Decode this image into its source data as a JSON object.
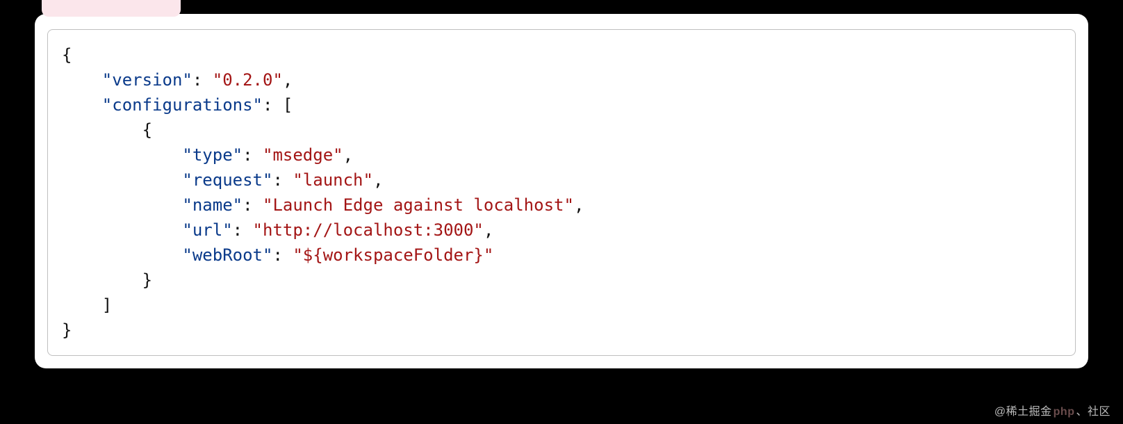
{
  "code": {
    "indent1": "    ",
    "indent2": "        ",
    "indent3": "            ",
    "open_brace": "{",
    "close_brace": "}",
    "open_bracket": "[",
    "close_bracket": "]",
    "colon_space": ": ",
    "comma": ",",
    "quote": "\"",
    "keys": {
      "version": "\"version\"",
      "configurations": "\"configurations\"",
      "type": "\"type\"",
      "request": "\"request\"",
      "name": "\"name\"",
      "url": "\"url\"",
      "webRoot": "\"webRoot\""
    },
    "values": {
      "version": "\"0.2.0\"",
      "type": "\"msedge\"",
      "request": "\"launch\"",
      "name": "\"Launch Edge against localhost\"",
      "url": "\"http://localhost:3000\"",
      "webRoot": "\"${workspaceFolder}\""
    }
  },
  "watermark": {
    "prefix": "@稀土掘金",
    "mid": "php",
    "suffix": "、社区"
  }
}
